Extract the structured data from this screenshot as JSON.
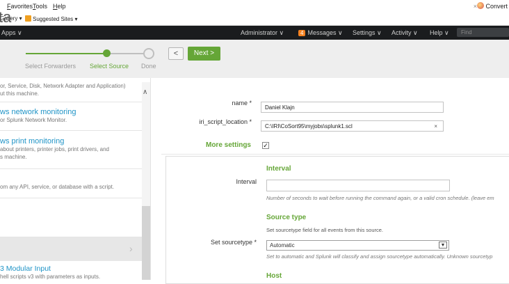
{
  "browser": {
    "menu": [
      {
        "pre": "F",
        "rest": "avorites"
      },
      {
        "pre": "T",
        "rest": "ools"
      },
      {
        "pre": "H",
        "rest": "elp"
      }
    ],
    "favorites": [
      "Gallery ▾",
      "Suggested Sites ▾"
    ],
    "close": "×",
    "convert": "Convert"
  },
  "appbar": {
    "apps": "Apps ∨",
    "administrator": "Administrator ∨",
    "messages_count": "4",
    "messages": "Messages ∨",
    "settings": "Settings ∨",
    "activity": "Activity ∨",
    "help": "Help ∨",
    "find": "Find"
  },
  "wizard": {
    "title": "ta",
    "steps": [
      "Select Forwarders",
      "Select Source",
      "Done"
    ],
    "prev": "<",
    "next": "Next >",
    "progress_step": 2,
    "steps_total": 3
  },
  "left_list": {
    "intro_desc": [
      "or, Service, Disk, Network Adapter and Application)",
      "ut this machine."
    ],
    "items": [
      {
        "title": "ws network monitoring",
        "desc": [
          "or Splunk Network Monitor."
        ]
      },
      {
        "title": "ws print monitoring",
        "desc": [
          "about printers, printer jobs, print drivers, and",
          "s machine."
        ]
      },
      {
        "title": "",
        "desc": [
          "om any API, service, or database with a script."
        ]
      },
      {
        "title": "3 Modular Input",
        "desc": [
          "hell scripts v3 with parameters as inputs."
        ]
      }
    ]
  },
  "form": {
    "name_label": "name *",
    "name_value": "Daniel Klajn",
    "script_label": "iri_script_location *",
    "script_value": "C:\\IRI\\CoSort95\\myjobs\\splunk1.scl",
    "clear": "×",
    "more_settings": "More settings",
    "more_checked": "✓",
    "interval_title": "Interval",
    "interval_label": "Interval",
    "interval_value": "",
    "interval_help": "Number of seconds to wait before running the command again, or a valid cron schedule. (leave em",
    "sourcetype_title": "Source type",
    "sourcetype_desc": "Set sourcetype field for all events from this source.",
    "sourcetype_label": "Set sourcetype *",
    "sourcetype_value": "Automatic",
    "sourcetype_help": "Set to automatic and Splunk will classify and assign sourcetype automatically. Unknown sourcetyp",
    "host_title": "Host"
  }
}
